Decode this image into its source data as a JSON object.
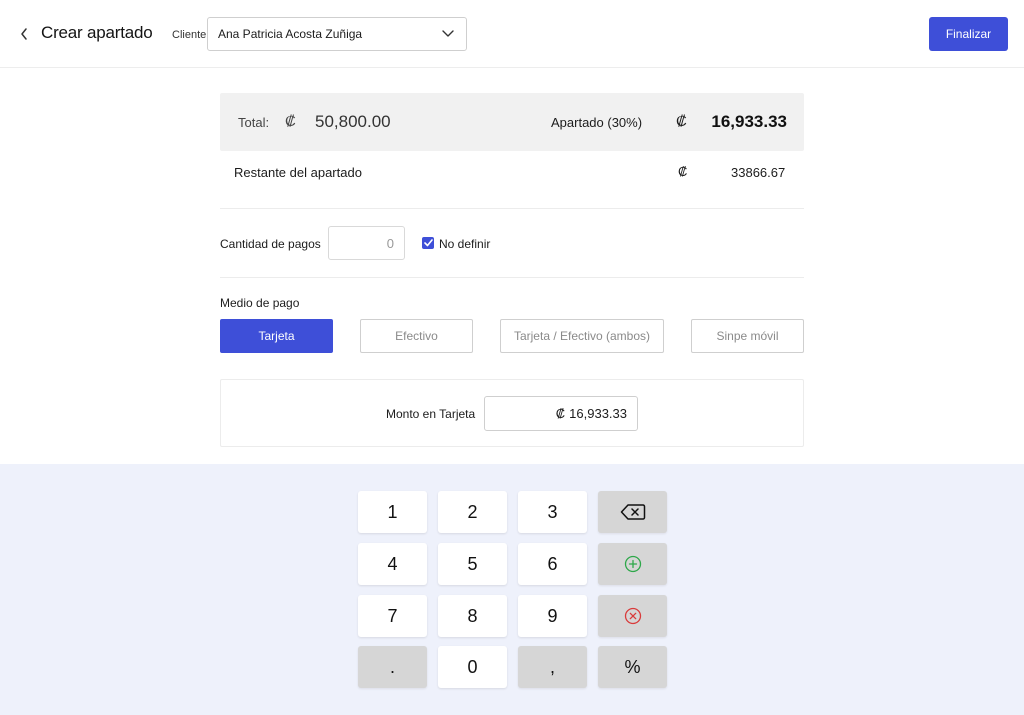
{
  "header": {
    "back_icon": "chevron-left-icon",
    "title": "Crear apartado",
    "client_label": "Cliente",
    "client_value": "Ana Patricia Acosta Zuñiga",
    "finalize_label": "Finalizar",
    "accent_color": "#3e4fd8"
  },
  "summary": {
    "total_label": "Total:",
    "currency_symbol": "₡",
    "total_value": "50,800.00",
    "apartado_label": "Apartado (30%)",
    "apartado_value": "16,933.33",
    "restante_label": "Restante del apartado",
    "restante_value": "33866.67"
  },
  "payments": {
    "cantidad_label": "Cantidad de pagos",
    "cantidad_value": "0",
    "no_definir_label": "No definir",
    "no_definir_checked": true
  },
  "medio": {
    "label": "Medio de pago",
    "options": [
      "Tarjeta",
      "Efectivo",
      "Tarjeta / Efectivo (ambos)",
      "Sinpe móvil"
    ],
    "selected": "Tarjeta"
  },
  "monto": {
    "label": "Monto en Tarjeta",
    "currency_symbol": "₡",
    "value": "16,933.33"
  },
  "keypad": {
    "k1": "1",
    "k2": "2",
    "k3": "3",
    "k4": "4",
    "k5": "5",
    "k6": "6",
    "k7": "7",
    "k8": "8",
    "k9": "9",
    "kdot": ".",
    "k0": "0",
    "kcomma": ",",
    "kpercent": "%",
    "backspace_icon": "backspace-icon",
    "add_icon": "plus-circle-icon",
    "remove_icon": "x-circle-icon"
  }
}
